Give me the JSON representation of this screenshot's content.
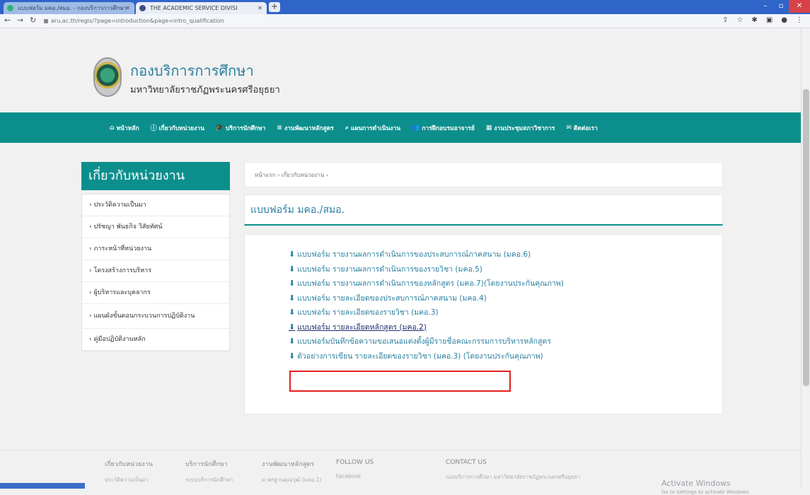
{
  "browser": {
    "tabs": [
      {
        "label": "แบบฟอร์ม มคอ./สมอ. - กองบริการการศึกษา"
      },
      {
        "label": "THE ACADEMIC SERVICE DIVISI"
      }
    ],
    "url": "aru.ac.th/regis/?page=introduction&page=intro_qualification"
  },
  "header": {
    "title": "กองบริการการศึกษา",
    "subtitle": "มหาวิทยาลัยราชภัฏพระนครศรีอยุธยา"
  },
  "menu": [
    {
      "icon": "home-icon",
      "label": "หน้าหลัก"
    },
    {
      "icon": "info-icon",
      "label": "เกี่ยวกับหน่วยงาน"
    },
    {
      "icon": "graduation-cap-icon",
      "label": "บริการนักศึกษา"
    },
    {
      "icon": "list-icon",
      "label": "งานพัฒนาหลักสูตร"
    },
    {
      "icon": "search-icon",
      "label": "แผนการดำเนินงาน"
    },
    {
      "icon": "users-icon",
      "label": "การฝึกอบรมอาจารย์"
    },
    {
      "icon": "calendar-icon",
      "label": "งานประชุมสภาวิชาการ"
    },
    {
      "icon": "contact-icon",
      "label": "ติดต่อเรา"
    }
  ],
  "sidebar": {
    "heading": "เกี่ยวกับหน่วยงาน",
    "items": [
      {
        "label": "› ประวัติความเป็นมา"
      },
      {
        "label": "› ปรัชญา พันธกิจ วิสัยทัศน์"
      },
      {
        "label": "› ภาระหน้าที่หน่วยงาน"
      },
      {
        "label": "› โครงสร้างการบริหาร"
      },
      {
        "label": "› ผู้บริหารและบุคลากร"
      },
      {
        "label": "› แผนผังขั้นตอนกระบวนการปฏิบัติงาน"
      },
      {
        "label": "› คู่มือปฏิบัติงานหลัก"
      }
    ]
  },
  "breadcrumb": "หน้าแรก › เกี่ยวกับหน่วยงาน ›",
  "section_title": "แบบฟอร์ม มคอ./สมอ.",
  "links": [
    {
      "label": "แบบฟอร์ม รายงานผลการดำเนินการของประสบการณ์ภาคสนาม (มคอ.6)"
    },
    {
      "label": "แบบฟอร์ม รายงานผลการดำเนินการของรายวิชา (มคอ.5)"
    },
    {
      "label": "แบบฟอร์ม รายงานผลการดำเนินการของหลักสูตร (มคอ.7)(โดยงานประกันคุณภาพ)"
    },
    {
      "label": "แบบฟอร์ม รายละเอียดของประสบการณ์ภาคสนาม (มคอ.4)"
    },
    {
      "label": "แบบฟอร์ม รายละเอียดของรายวิชา (มคอ.3)"
    },
    {
      "label": "แบบฟอร์ม รายละเอียดหลักสูตร (มคอ.2)"
    },
    {
      "label": "แบบฟอร์มบันทึกข้อความขอเสนอแต่งตั้งผู้มีรายชื่อคณะกรรมการบริหารหลักสูตร"
    },
    {
      "label": "ตัวอย่างการเขียน รายละเอียดของรายวิชา (มคอ.3) (โดยงานประกันคุณภาพ)"
    }
  ],
  "footer": {
    "columns": [
      {
        "heading": "เกี่ยวกับหน่วยงาน",
        "item": "ประวัติความเป็นมา"
      },
      {
        "heading": "บริการนักศึกษา",
        "item": "ระบบบริการนักศึกษา"
      },
      {
        "heading": "งานพัฒนาหลักสูตร",
        "item": "มาตรฐานคุณวุฒิ (มคอ.1)"
      },
      {
        "heading": "FOLLOW US",
        "item": "Facebook"
      },
      {
        "heading": "CONTACT US",
        "item": "กองบริการการศึกษา มหาวิทยาลัยราชภัฏพระนครศรีอยุธยา"
      }
    ],
    "activate_title": "Activate Windows",
    "activate_sub": "Go to Settings to activate Windows."
  }
}
